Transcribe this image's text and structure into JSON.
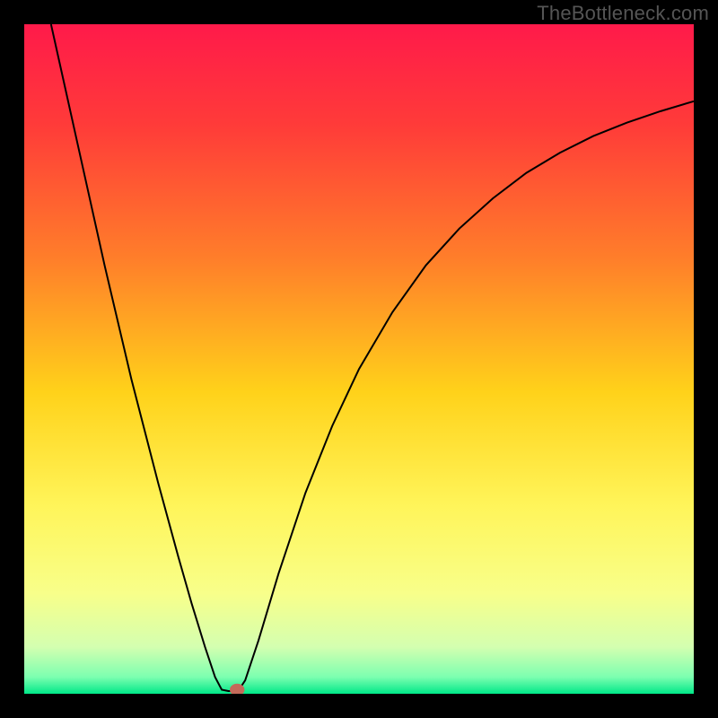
{
  "watermark": "TheBottleneck.com",
  "chart_data": {
    "type": "line",
    "title": "",
    "xlabel": "",
    "ylabel": "",
    "xlim": [
      0,
      100
    ],
    "ylim": [
      0,
      100
    ],
    "grid": false,
    "background_gradient_stops": [
      {
        "offset": 0.0,
        "color": "#ff1a4a"
      },
      {
        "offset": 0.15,
        "color": "#ff3b39"
      },
      {
        "offset": 0.35,
        "color": "#ff7e2a"
      },
      {
        "offset": 0.55,
        "color": "#ffd21a"
      },
      {
        "offset": 0.72,
        "color": "#fff55a"
      },
      {
        "offset": 0.85,
        "color": "#f8ff8a"
      },
      {
        "offset": 0.93,
        "color": "#d4ffb0"
      },
      {
        "offset": 0.975,
        "color": "#7cffb0"
      },
      {
        "offset": 1.0,
        "color": "#00e889"
      }
    ],
    "curve": {
      "color": "#000000",
      "stroke_width": 2,
      "points": [
        {
          "x": 4.0,
          "y": 100.0
        },
        {
          "x": 6.0,
          "y": 91.0
        },
        {
          "x": 8.0,
          "y": 82.0
        },
        {
          "x": 12.0,
          "y": 64.0
        },
        {
          "x": 16.0,
          "y": 47.0
        },
        {
          "x": 20.0,
          "y": 31.5
        },
        {
          "x": 23.0,
          "y": 20.5
        },
        {
          "x": 25.0,
          "y": 13.5
        },
        {
          "x": 27.0,
          "y": 7.0
        },
        {
          "x": 28.5,
          "y": 2.5
        },
        {
          "x": 29.5,
          "y": 0.6
        },
        {
          "x": 30.5,
          "y": 0.4
        },
        {
          "x": 31.4,
          "y": 0.4
        },
        {
          "x": 32.0,
          "y": 0.5
        },
        {
          "x": 33.0,
          "y": 2.0
        },
        {
          "x": 35.0,
          "y": 8.0
        },
        {
          "x": 38.0,
          "y": 18.0
        },
        {
          "x": 42.0,
          "y": 30.0
        },
        {
          "x": 46.0,
          "y": 40.0
        },
        {
          "x": 50.0,
          "y": 48.5
        },
        {
          "x": 55.0,
          "y": 57.0
        },
        {
          "x": 60.0,
          "y": 64.0
        },
        {
          "x": 65.0,
          "y": 69.5
        },
        {
          "x": 70.0,
          "y": 74.0
        },
        {
          "x": 75.0,
          "y": 77.8
        },
        {
          "x": 80.0,
          "y": 80.8
        },
        {
          "x": 85.0,
          "y": 83.3
        },
        {
          "x": 90.0,
          "y": 85.3
        },
        {
          "x": 95.0,
          "y": 87.0
        },
        {
          "x": 100.0,
          "y": 88.5
        }
      ]
    },
    "marker": {
      "x": 31.8,
      "y": 0.6,
      "rx": 1.1,
      "ry": 0.9,
      "fill": "#c46a5a"
    }
  }
}
